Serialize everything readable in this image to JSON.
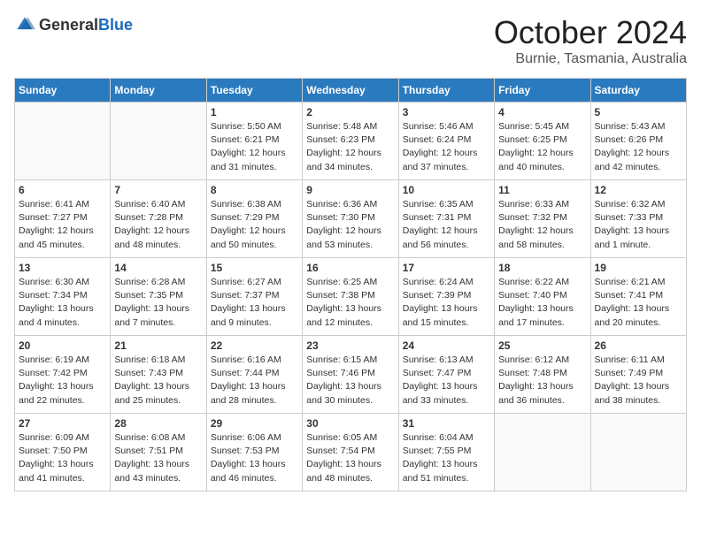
{
  "header": {
    "logo_general": "General",
    "logo_blue": "Blue",
    "month_title": "October 2024",
    "location": "Burnie, Tasmania, Australia"
  },
  "days_of_week": [
    "Sunday",
    "Monday",
    "Tuesday",
    "Wednesday",
    "Thursday",
    "Friday",
    "Saturday"
  ],
  "weeks": [
    [
      {
        "day": "",
        "empty": true
      },
      {
        "day": "",
        "empty": true
      },
      {
        "day": "1",
        "sunrise": "Sunrise: 5:50 AM",
        "sunset": "Sunset: 6:21 PM",
        "daylight": "Daylight: 12 hours and 31 minutes."
      },
      {
        "day": "2",
        "sunrise": "Sunrise: 5:48 AM",
        "sunset": "Sunset: 6:23 PM",
        "daylight": "Daylight: 12 hours and 34 minutes."
      },
      {
        "day": "3",
        "sunrise": "Sunrise: 5:46 AM",
        "sunset": "Sunset: 6:24 PM",
        "daylight": "Daylight: 12 hours and 37 minutes."
      },
      {
        "day": "4",
        "sunrise": "Sunrise: 5:45 AM",
        "sunset": "Sunset: 6:25 PM",
        "daylight": "Daylight: 12 hours and 40 minutes."
      },
      {
        "day": "5",
        "sunrise": "Sunrise: 5:43 AM",
        "sunset": "Sunset: 6:26 PM",
        "daylight": "Daylight: 12 hours and 42 minutes."
      }
    ],
    [
      {
        "day": "6",
        "sunrise": "Sunrise: 6:41 AM",
        "sunset": "Sunset: 7:27 PM",
        "daylight": "Daylight: 12 hours and 45 minutes."
      },
      {
        "day": "7",
        "sunrise": "Sunrise: 6:40 AM",
        "sunset": "Sunset: 7:28 PM",
        "daylight": "Daylight: 12 hours and 48 minutes."
      },
      {
        "day": "8",
        "sunrise": "Sunrise: 6:38 AM",
        "sunset": "Sunset: 7:29 PM",
        "daylight": "Daylight: 12 hours and 50 minutes."
      },
      {
        "day": "9",
        "sunrise": "Sunrise: 6:36 AM",
        "sunset": "Sunset: 7:30 PM",
        "daylight": "Daylight: 12 hours and 53 minutes."
      },
      {
        "day": "10",
        "sunrise": "Sunrise: 6:35 AM",
        "sunset": "Sunset: 7:31 PM",
        "daylight": "Daylight: 12 hours and 56 minutes."
      },
      {
        "day": "11",
        "sunrise": "Sunrise: 6:33 AM",
        "sunset": "Sunset: 7:32 PM",
        "daylight": "Daylight: 12 hours and 58 minutes."
      },
      {
        "day": "12",
        "sunrise": "Sunrise: 6:32 AM",
        "sunset": "Sunset: 7:33 PM",
        "daylight": "Daylight: 13 hours and 1 minute."
      }
    ],
    [
      {
        "day": "13",
        "sunrise": "Sunrise: 6:30 AM",
        "sunset": "Sunset: 7:34 PM",
        "daylight": "Daylight: 13 hours and 4 minutes."
      },
      {
        "day": "14",
        "sunrise": "Sunrise: 6:28 AM",
        "sunset": "Sunset: 7:35 PM",
        "daylight": "Daylight: 13 hours and 7 minutes."
      },
      {
        "day": "15",
        "sunrise": "Sunrise: 6:27 AM",
        "sunset": "Sunset: 7:37 PM",
        "daylight": "Daylight: 13 hours and 9 minutes."
      },
      {
        "day": "16",
        "sunrise": "Sunrise: 6:25 AM",
        "sunset": "Sunset: 7:38 PM",
        "daylight": "Daylight: 13 hours and 12 minutes."
      },
      {
        "day": "17",
        "sunrise": "Sunrise: 6:24 AM",
        "sunset": "Sunset: 7:39 PM",
        "daylight": "Daylight: 13 hours and 15 minutes."
      },
      {
        "day": "18",
        "sunrise": "Sunrise: 6:22 AM",
        "sunset": "Sunset: 7:40 PM",
        "daylight": "Daylight: 13 hours and 17 minutes."
      },
      {
        "day": "19",
        "sunrise": "Sunrise: 6:21 AM",
        "sunset": "Sunset: 7:41 PM",
        "daylight": "Daylight: 13 hours and 20 minutes."
      }
    ],
    [
      {
        "day": "20",
        "sunrise": "Sunrise: 6:19 AM",
        "sunset": "Sunset: 7:42 PM",
        "daylight": "Daylight: 13 hours and 22 minutes."
      },
      {
        "day": "21",
        "sunrise": "Sunrise: 6:18 AM",
        "sunset": "Sunset: 7:43 PM",
        "daylight": "Daylight: 13 hours and 25 minutes."
      },
      {
        "day": "22",
        "sunrise": "Sunrise: 6:16 AM",
        "sunset": "Sunset: 7:44 PM",
        "daylight": "Daylight: 13 hours and 28 minutes."
      },
      {
        "day": "23",
        "sunrise": "Sunrise: 6:15 AM",
        "sunset": "Sunset: 7:46 PM",
        "daylight": "Daylight: 13 hours and 30 minutes."
      },
      {
        "day": "24",
        "sunrise": "Sunrise: 6:13 AM",
        "sunset": "Sunset: 7:47 PM",
        "daylight": "Daylight: 13 hours and 33 minutes."
      },
      {
        "day": "25",
        "sunrise": "Sunrise: 6:12 AM",
        "sunset": "Sunset: 7:48 PM",
        "daylight": "Daylight: 13 hours and 36 minutes."
      },
      {
        "day": "26",
        "sunrise": "Sunrise: 6:11 AM",
        "sunset": "Sunset: 7:49 PM",
        "daylight": "Daylight: 13 hours and 38 minutes."
      }
    ],
    [
      {
        "day": "27",
        "sunrise": "Sunrise: 6:09 AM",
        "sunset": "Sunset: 7:50 PM",
        "daylight": "Daylight: 13 hours and 41 minutes."
      },
      {
        "day": "28",
        "sunrise": "Sunrise: 6:08 AM",
        "sunset": "Sunset: 7:51 PM",
        "daylight": "Daylight: 13 hours and 43 minutes."
      },
      {
        "day": "29",
        "sunrise": "Sunrise: 6:06 AM",
        "sunset": "Sunset: 7:53 PM",
        "daylight": "Daylight: 13 hours and 46 minutes."
      },
      {
        "day": "30",
        "sunrise": "Sunrise: 6:05 AM",
        "sunset": "Sunset: 7:54 PM",
        "daylight": "Daylight: 13 hours and 48 minutes."
      },
      {
        "day": "31",
        "sunrise": "Sunrise: 6:04 AM",
        "sunset": "Sunset: 7:55 PM",
        "daylight": "Daylight: 13 hours and 51 minutes."
      },
      {
        "day": "",
        "empty": true
      },
      {
        "day": "",
        "empty": true
      }
    ]
  ]
}
